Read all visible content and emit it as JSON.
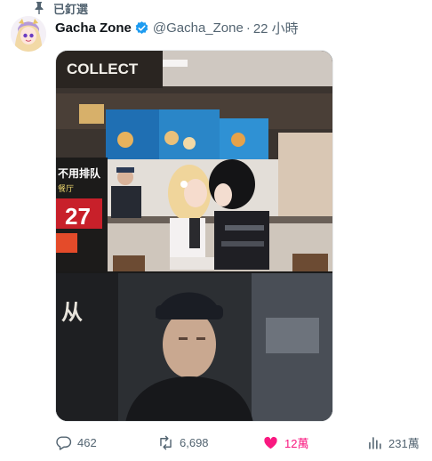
{
  "pinned": {
    "label": "已釘選",
    "icon": "pin-icon"
  },
  "tweet": {
    "display_name": "Gacha Zone",
    "handle": "@Gacha_Zone",
    "separator": "·",
    "time": "22 小時",
    "verified_icon": "verified-badge-icon",
    "media": {
      "sign_text": "COLLECT",
      "poster_line1": "不用排队",
      "poster_line2": "餐厅",
      "poster_price": "27",
      "crop_text": "从"
    }
  },
  "actions": {
    "reply_count": "462",
    "retweet_count": "6,698",
    "like_count": "12萬",
    "view_count": "231萬"
  },
  "colors": {
    "like": "#f91880",
    "muted": "#536471",
    "verified": "#1d9bf0"
  }
}
